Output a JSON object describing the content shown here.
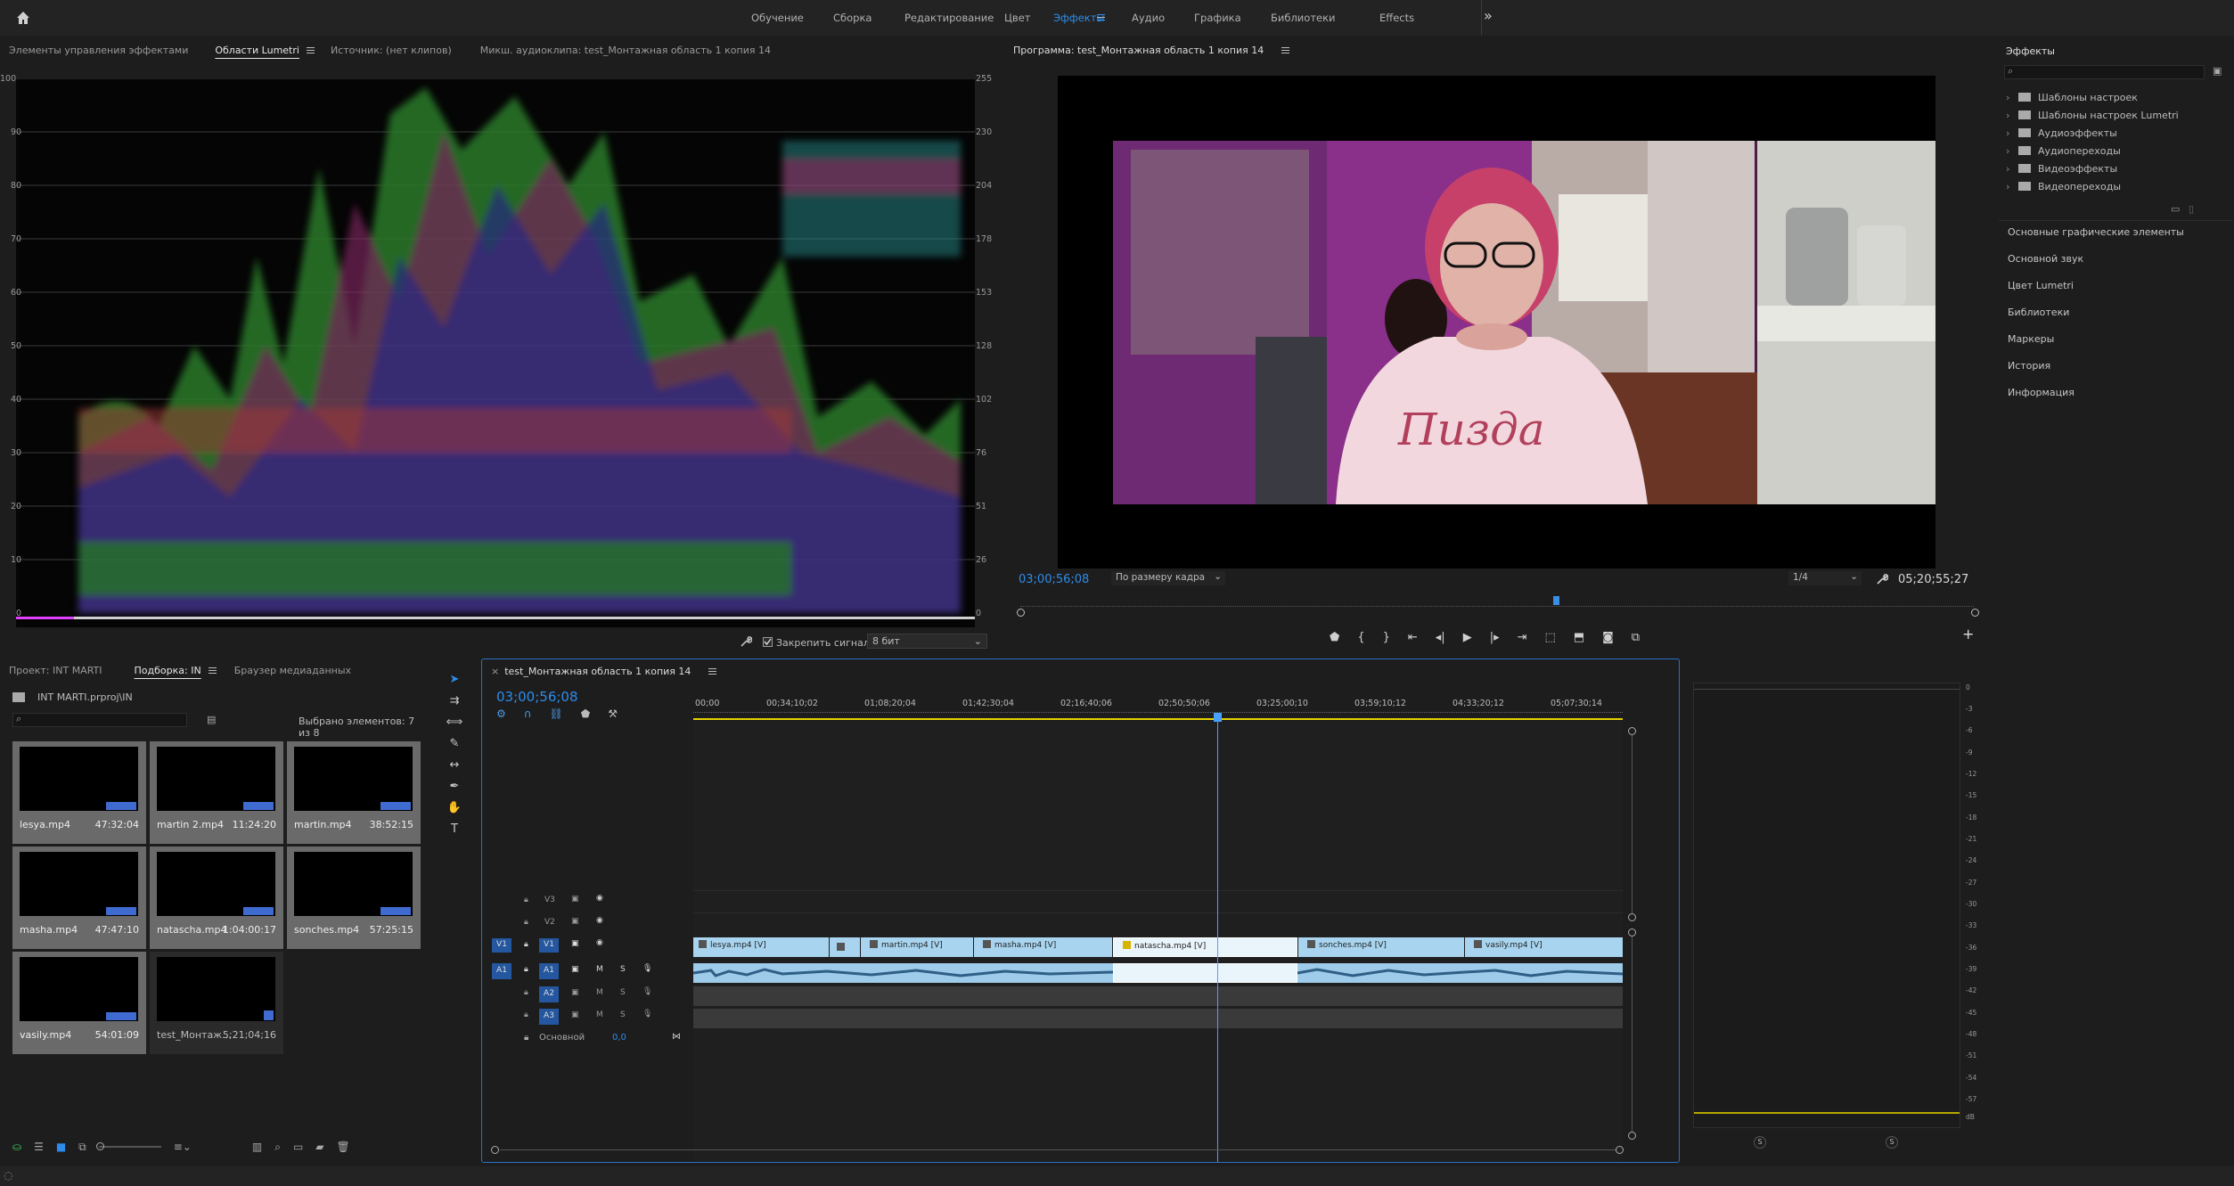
{
  "topbar": {
    "workspaces": [
      "Обучение",
      "Сборка",
      "Редактирование",
      "Цвет",
      "Эффекты",
      "Аудио",
      "Графика",
      "Библиотеки",
      "Effects"
    ],
    "active_workspace": "Эффекты",
    "more": "»"
  },
  "left_top_tabs": [
    "Элементы управления эффектами",
    "Области Lumetri",
    "Источник: (нет клипов)",
    "Микш. аудиоклипа: test_Монтажная область 1 копия 14"
  ],
  "lumetri": {
    "left_scale": [
      "100",
      "90",
      "80",
      "70",
      "60",
      "50",
      "40",
      "30",
      "20",
      "10",
      "0"
    ],
    "right_scale": [
      "255",
      "230",
      "204",
      "178",
      "153",
      "128",
      "102",
      "76",
      "51",
      "26",
      "0"
    ],
    "clamp_label": "Закрепить сигнал",
    "bit_depth": "8 бит"
  },
  "program": {
    "title": "Программа: test_Монтажная область 1 копия 14",
    "timecode": "03;00;56;08",
    "fit": "По размеру кадра",
    "quality": "1/4",
    "duration": "05;20;55;27"
  },
  "effects_panel": {
    "title": "Эффекты",
    "search_placeholder": "",
    "folders": [
      "Шаблоны настроек",
      "Шаблоны настроек Lumetri",
      "Аудиоэффекты",
      "Аудиопереходы",
      "Видеоэффекты",
      "Видеопереходы"
    ],
    "sections": [
      "Основные графические элементы",
      "Основной звук",
      "Цвет Lumetri",
      "Библиотеки",
      "Маркеры",
      "История",
      "Информация"
    ]
  },
  "project": {
    "tabs": [
      "Проект: INT MARTI",
      "Подборка: IN",
      "Браузер медиаданных"
    ],
    "path": "INT MARTI.prproj\\IN",
    "selected": "Выбрано элементов: 7 из 8",
    "items": [
      {
        "name": "lesya.mp4",
        "dur": "47:32:04"
      },
      {
        "name": "martin 2.mp4",
        "dur": "11:24:20"
      },
      {
        "name": "martin.mp4",
        "dur": "38:52:15"
      },
      {
        "name": "masha.mp4",
        "dur": "47:47:10"
      },
      {
        "name": "natascha.mp4",
        "dur": "1:04:00:17"
      },
      {
        "name": "sonches.mp4",
        "dur": "57:25:15"
      },
      {
        "name": "vasily.mp4",
        "dur": "54:01:09"
      },
      {
        "name": "test_Монтаж...",
        "dur": "5;21;04;16"
      }
    ]
  },
  "timeline": {
    "tab": "test_Монтажная область 1 копия 14",
    "timecode": "03;00;56;08",
    "ruler": [
      "00;00",
      "00;34;10;02",
      "01;08;20;04",
      "01;42;30;04",
      "02;16;40;06",
      "02;50;50;06",
      "03;25;00;10",
      "03;59;10;12",
      "04;33;20;12",
      "05;07;30;14"
    ],
    "tracks_video": [
      "V3",
      "V2",
      "V1"
    ],
    "tracks_audio": [
      "A1",
      "A2",
      "A3"
    ],
    "master_label": "Основной",
    "master_value": "0,0",
    "clips": [
      "lesya.mp4 [V]",
      "martin.mp4 [V]",
      "masha.mp4 [V]",
      "natascha.mp4 [V]",
      "sonches.mp4 [V]",
      "vasily.mp4 [V]"
    ]
  },
  "meter": {
    "scale": [
      "0",
      "-3",
      "-6",
      "-9",
      "-12",
      "-15",
      "-18",
      "-21",
      "-24",
      "-27",
      "-30",
      "-33",
      "-36",
      "-39",
      "-42",
      "-45",
      "-48",
      "-51",
      "-54",
      "-57",
      "dB"
    ],
    "solo": "S"
  },
  "overlay_text": "Пизда",
  "colors": {
    "accent": "#2d8ceb",
    "clip_video": "#a8d4ef",
    "clip_audio": "#9dcbe9",
    "playhead": "#4aa0ff",
    "work_area": "#e6d200"
  }
}
